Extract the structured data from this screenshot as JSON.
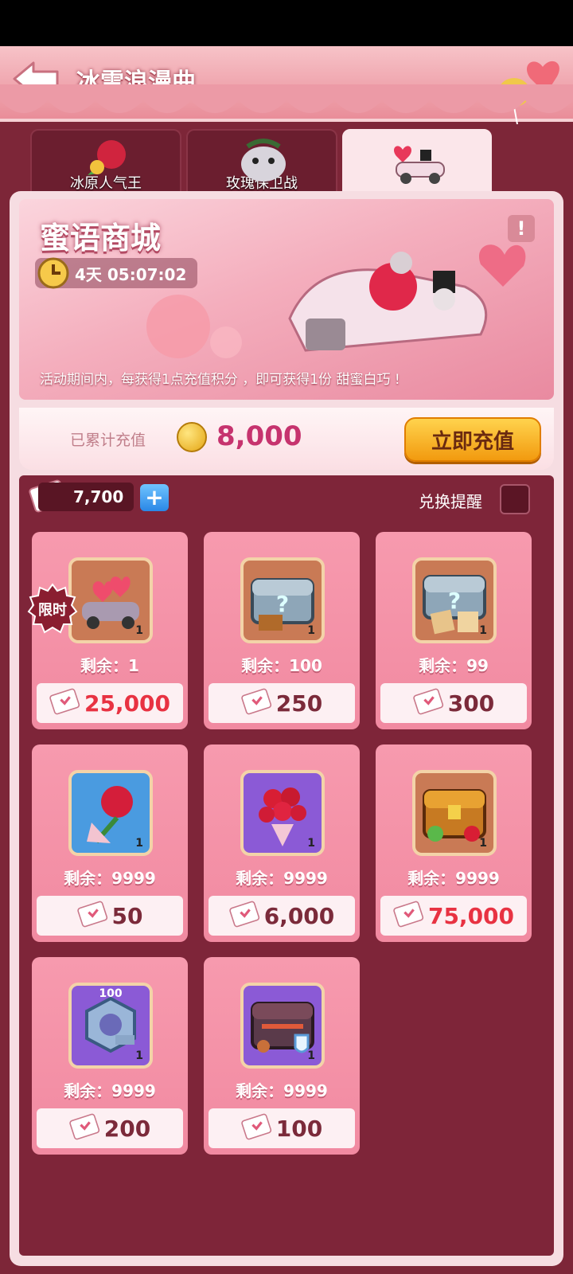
{
  "header": {
    "title": "冰雪浪漫曲"
  },
  "tabs": [
    {
      "label": "冰原人气王"
    },
    {
      "label": "玫瑰保卫战"
    },
    {
      "label": ""
    }
  ],
  "banner": {
    "title": "蜜语商城",
    "timer": "4天 05:07:02",
    "info": "!",
    "description": "活动期间内，每获得1点充值积分 ，即可获得1份 甜蜜白巧 !"
  },
  "recharge": {
    "label": "已累计充值",
    "value": "8,000",
    "button": "立即充值"
  },
  "currency": {
    "amount": "7,700",
    "plus": "+",
    "remind_label": "兑换提醒"
  },
  "limited_badge": "限时",
  "items": [
    {
      "name": "car",
      "qty": "1",
      "remain": "剩余：1",
      "price": "25,000",
      "price_red": true,
      "bg": "#c97a55"
    },
    {
      "name": "chest-silver",
      "qty": "1",
      "remain": "剩余：100",
      "price": "250",
      "price_red": false,
      "bg": "#c97a55"
    },
    {
      "name": "chest-silver-2",
      "qty": "1",
      "remain": "剩余：99",
      "price": "300",
      "price_red": false,
      "bg": "#c97a55"
    },
    {
      "name": "rose",
      "qty": "1",
      "remain": "剩余：9999",
      "price": "50",
      "price_red": false,
      "bg": "#4a9be0"
    },
    {
      "name": "bouquet",
      "qty": "1",
      "remain": "剩余：9999",
      "price": "6,000",
      "price_red": false,
      "bg": "#8b5ad6"
    },
    {
      "name": "chest-gold",
      "qty": "1",
      "remain": "剩余：9999",
      "price": "75,000",
      "price_red": true,
      "bg": "#c97a55"
    },
    {
      "name": "hex-nut",
      "qty": "1",
      "badge": "100",
      "remain": "剩余：9999",
      "price": "200",
      "price_red": false,
      "bg": "#8b5ad6"
    },
    {
      "name": "chest-dark",
      "qty": "1",
      "remain": "剩余：9999",
      "price": "100",
      "price_red": false,
      "bg": "#8b5ad6"
    }
  ]
}
